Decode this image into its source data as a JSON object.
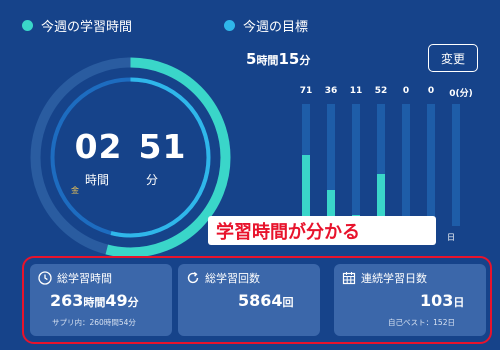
{
  "legend": {
    "study_label": "今週の学習時間",
    "goal_label": "今週の目標",
    "study_color": "#3ad6c9",
    "goal_color": "#2fb7ea"
  },
  "clock": {
    "hours": "02",
    "minutes": "51",
    "hour_unit": "時間",
    "minute_unit": "分",
    "weekday_mark": "金",
    "progress_fraction": 0.54
  },
  "goal": {
    "hours": "5",
    "hour_unit": "時間",
    "minutes": "15",
    "minute_unit": "分",
    "change_label": "変更"
  },
  "daily": {
    "values": [
      "71",
      "36",
      "11",
      "52",
      "0",
      "0",
      "0"
    ],
    "max": 122,
    "last_unit": "(分)",
    "last_day_label": "日"
  },
  "banner": {
    "text": "学習時間が分かる",
    "color": "#e8132c"
  },
  "stats": {
    "total_time": {
      "title": "総学習時間",
      "hours": "263",
      "hour_unit": "時間",
      "minutes": "49",
      "minute_unit": "分",
      "sub": "サプリ内：260時間54分",
      "icon": "clock-icon"
    },
    "total_count": {
      "title": "総学習回数",
      "value": "5864",
      "unit": "回",
      "icon": "refresh-icon"
    },
    "streak": {
      "title": "連続学習日数",
      "value": "103",
      "unit": "日",
      "sub": "自己ベスト：152日",
      "icon": "calendar-icon"
    }
  }
}
